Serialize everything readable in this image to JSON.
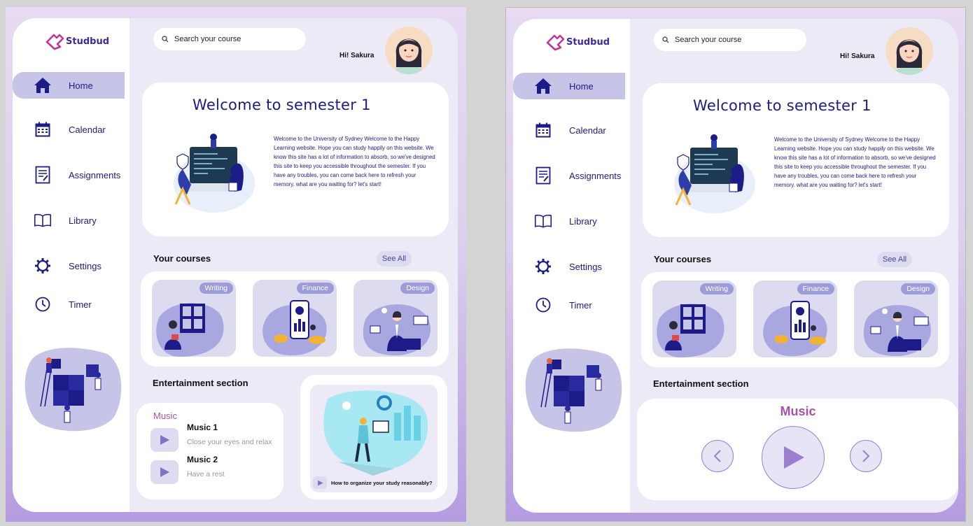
{
  "brand": {
    "name": "Studbud"
  },
  "search": {
    "placeholder": "Search your course"
  },
  "greeting": "Hi! Sakura",
  "nav": [
    {
      "label": "Home",
      "icon": "home-icon",
      "active": true
    },
    {
      "label": "Calendar",
      "icon": "calendar-icon"
    },
    {
      "label": "Assignments",
      "icon": "assignment-icon"
    },
    {
      "label": "Library",
      "icon": "book-icon"
    },
    {
      "label": "Settings",
      "icon": "gear-icon"
    },
    {
      "label": "Timer",
      "icon": "clock-icon"
    }
  ],
  "welcome": {
    "title": "Welcome to  semester 1",
    "body": "Welcome to the University of Sydney Welcome to the Happy Learning website. Hope you can study happily on this website. We know this site has a lot of information to absorb, so we've designed this site to keep you accessible throughout the semester. If you have any troubles, you can come back here to refresh your memory. what are you waiting for? let's start!"
  },
  "courses": {
    "title": "Your courses",
    "see_all": "See All",
    "items": [
      "Writing",
      "Finance",
      "Design"
    ]
  },
  "entertainment": {
    "title": "Entertainment section",
    "music_label": "Music",
    "tracks": [
      {
        "name": "Music 1",
        "subtitle": "Close your eyes and relax"
      },
      {
        "name": "Music 2",
        "subtitle": "Have a rest"
      }
    ],
    "video_caption": "How to organize your study reasonably?"
  },
  "player": {
    "title": "Music"
  },
  "colors": {
    "accent": "#1c1b87",
    "music": "#a851a8",
    "active_nav": "#c6c5e8",
    "tag": "#9c9cd8"
  }
}
